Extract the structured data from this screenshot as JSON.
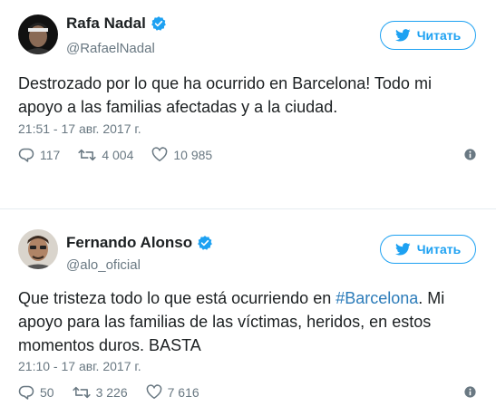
{
  "tweets": [
    {
      "name": "Rafa Nadal",
      "handle": "@RafaelNadal",
      "follow_label": "Читать",
      "text": "Destrozado por lo que ha ocurrido en Barcelona! Todo mi apoyo a las familias afectadas y a la ciudad.",
      "time": "21:51 - 17 авг. 2017 г.",
      "replies": "117",
      "retweets": "4 004",
      "likes": "10 985"
    },
    {
      "name": "Fernando Alonso",
      "handle": "@alo_oficial",
      "follow_label": "Читать",
      "text_before": "Que tristeza todo lo que está ocurriendo en ",
      "hashtag": "#Barcelona",
      "text_after": ". Mi apoyo para las familias de las víctimas, heridos, en estos momentos duros. BASTA",
      "time": "21:10 - 17 авг. 2017 г.",
      "replies": "50",
      "retweets": "3 226",
      "likes": "7 616"
    }
  ],
  "colors": {
    "accent": "#1da1f2",
    "verified": "#1da1f2",
    "secondary_text": "#697882",
    "hashtag": "#2b7bb9"
  },
  "icons": [
    "verified-badge-icon",
    "twitter-bird-icon",
    "reply-icon",
    "retweet-icon",
    "like-heart-icon",
    "info-icon"
  ]
}
